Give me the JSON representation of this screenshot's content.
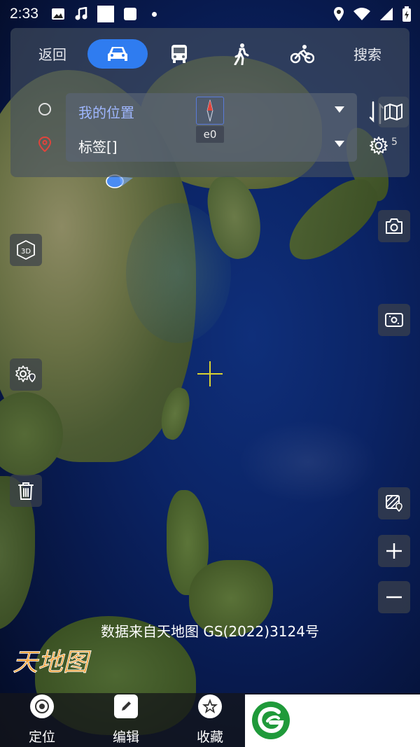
{
  "status_bar": {
    "time": "2:33",
    "left_icons": [
      "image-icon",
      "music-icon",
      "square-icon",
      "square-small-icon",
      "dot-icon"
    ],
    "right_icons": [
      "location-icon",
      "wifi-icon",
      "signal-icon",
      "battery-icon"
    ]
  },
  "route_panel": {
    "back_label": "返回",
    "search_label": "搜索",
    "modes": [
      {
        "name": "car-icon",
        "active": true
      },
      {
        "name": "bus-icon",
        "active": false
      },
      {
        "name": "walk-icon",
        "active": false
      },
      {
        "name": "bike-icon",
        "active": false
      }
    ],
    "start_value": "我的位置",
    "end_value": "标签[]",
    "compass_label": "e0",
    "gear_count": "5"
  },
  "map": {
    "attribution": "数据来自天地图 GS(2022)3124号",
    "logo_text": "天地图"
  },
  "bottom_bar": {
    "tabs": [
      {
        "label": "定位",
        "icon": "locate-icon"
      },
      {
        "label": "编辑",
        "icon": "edit-icon"
      },
      {
        "label": "收藏",
        "icon": "favorite-icon"
      }
    ]
  },
  "colors": {
    "accent": "#2f7cf0",
    "crosshair": "#d9d231",
    "end_marker": "#e0443c",
    "ad_logo": "#1f9a3a"
  }
}
